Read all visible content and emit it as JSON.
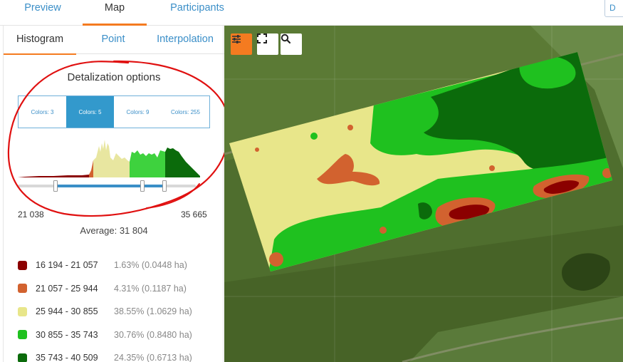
{
  "top_tabs": [
    {
      "label": "Preview",
      "active": false
    },
    {
      "label": "Map",
      "active": true
    },
    {
      "label": "Participants",
      "active": false
    }
  ],
  "top_right_button": "D",
  "sub_tabs": [
    {
      "label": "Histogram",
      "active": true
    },
    {
      "label": "Point",
      "active": false
    },
    {
      "label": "Interpolation",
      "active": false
    }
  ],
  "detalization": {
    "title": "Detalization options",
    "options": [
      "Colors: 3",
      "Colors: 5",
      "Colors: 9",
      "Colors: 255"
    ],
    "selected": "Colors: 5"
  },
  "range": {
    "min": "21 038",
    "max": "35 665"
  },
  "average": "Average: 31 804",
  "legend": [
    {
      "range": "16 194 - 21 057",
      "pct": "1.63% (0.0448 ha)",
      "color": "#8b0000"
    },
    {
      "range": "21 057 - 25 944",
      "pct": "4.31% (0.1187 ha)",
      "color": "#d2622f"
    },
    {
      "range": "25 944 - 30 855",
      "pct": "38.55% (1.0629 ha)",
      "color": "#e8e68a"
    },
    {
      "range": "30 855 - 35 743",
      "pct": "30.76% (0.8480 ha)",
      "color": "#1fc11f"
    },
    {
      "range": "35 743 - 40 509",
      "pct": "24.35% (0.6713 ha)",
      "color": "#0b6b0b"
    }
  ],
  "colors": {
    "accent": "#f47b20",
    "link": "#3b8fc8",
    "selected": "#3399cc",
    "annotation": "#e01010"
  },
  "icons": {
    "settings": "sliders-icon",
    "fullscreen": "fullscreen-icon",
    "search": "search-icon"
  }
}
